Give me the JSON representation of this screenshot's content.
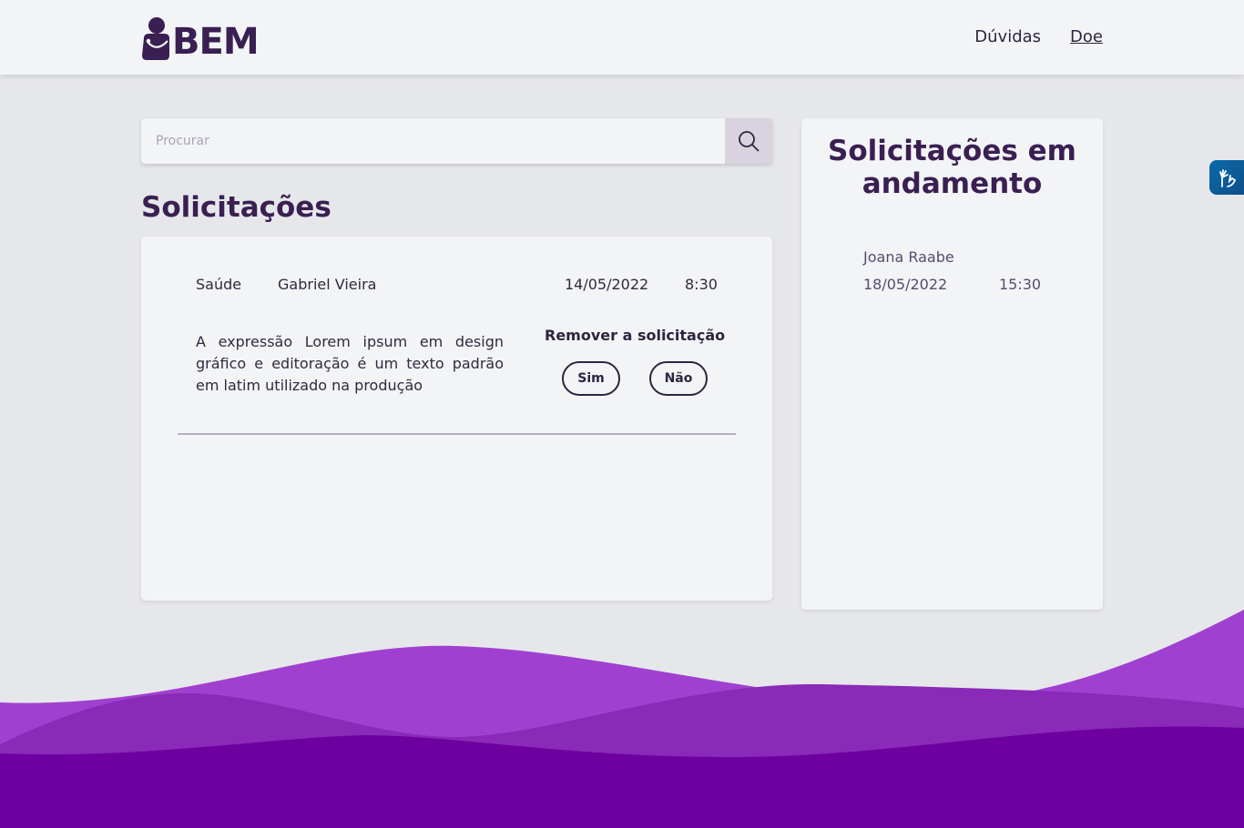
{
  "header": {
    "logo_text": "BEM",
    "nav": [
      {
        "label": "Dúvidas"
      },
      {
        "label": "Doe"
      }
    ]
  },
  "search": {
    "placeholder": "Procurar",
    "value": "",
    "icon": "search-icon"
  },
  "main": {
    "title": "Solicitações",
    "request": {
      "category": "Saúde",
      "name": "Gabriel Vieira",
      "date": "14/05/2022",
      "time": "8:30",
      "description": "A expressão Lorem ipsum em design gráfico e editoração é um texto padrão em latim utilizado na produção",
      "remove_label": "Remover a solicitação",
      "yes_label": "Sim",
      "no_label": "Não"
    }
  },
  "side": {
    "title": "Solicitações em andamento",
    "item": {
      "name": "Joana Raabe",
      "date": "18/05/2022",
      "time": "15:30"
    }
  },
  "accessibility": {
    "icon": "sign-language-icon"
  },
  "colors": {
    "brand": "#3a1f52",
    "wave_light": "#a040d0",
    "wave_mid": "#8a2ab8",
    "wave_dark": "#6e00a0"
  }
}
